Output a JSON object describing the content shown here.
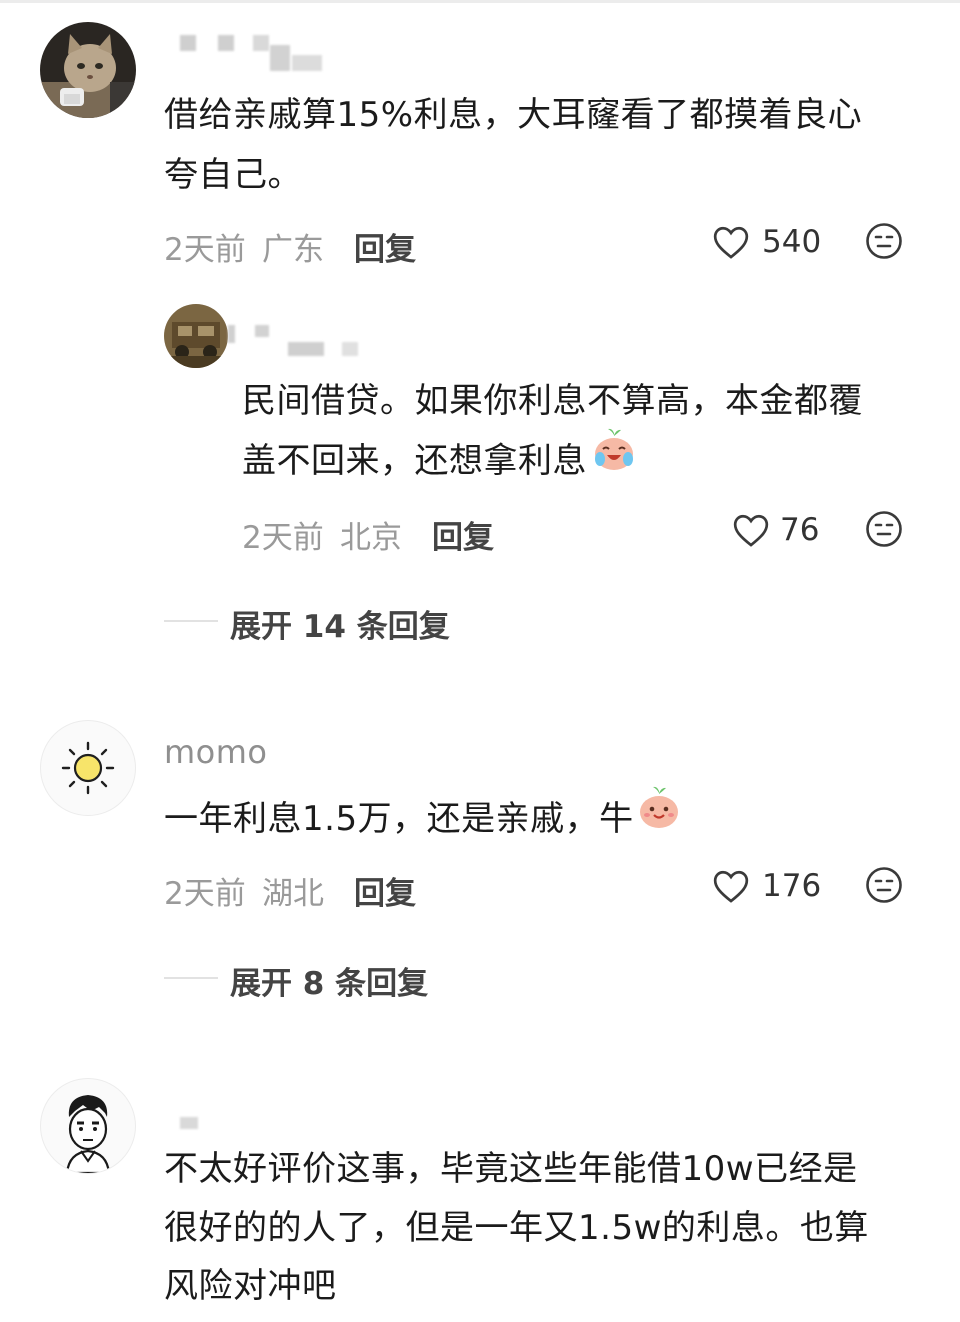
{
  "comments": [
    {
      "content_line1": "借给亲戚算15%利息，大耳窿看了都摸着良心",
      "content_line2": "夸自己。",
      "time": "2天前",
      "location": "广东",
      "reply_label": "回复",
      "likes": "540",
      "reply": {
        "content_line1": "民间借贷。如果你利息不算高，本金都覆",
        "content_line2": "盖不回来，还想拿利息",
        "time": "2天前",
        "location": "北京",
        "reply_label": "回复",
        "likes": "76"
      },
      "expand_label": "展开 14 条回复"
    },
    {
      "username": "momo",
      "content_line1": "一年利息1.5万，还是亲戚，牛",
      "time": "2天前",
      "location": "湖北",
      "reply_label": "回复",
      "likes": "176",
      "expand_label": "展开 8 条回复"
    },
    {
      "content_line1": "不太好评价这事，毕竟这些年能借10w已经是",
      "content_line2": "很好的的人了，但是一年又1.5w的利息。也算",
      "content_line3": "风险对冲吧"
    }
  ],
  "colors": {
    "text": "#1b1b1b",
    "meta": "#9a9a9a",
    "reply": "#444444"
  },
  "icons": [
    "heart-icon",
    "emoji-reaction-icon",
    "laugh-cry-emoji",
    "smile-emoji"
  ]
}
